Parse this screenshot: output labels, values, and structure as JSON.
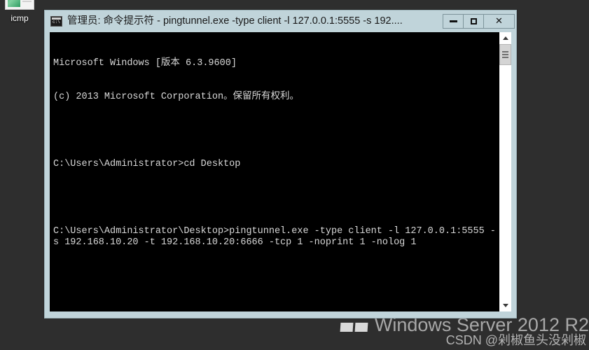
{
  "desktop": {
    "background_color": "#2e2e2e",
    "shortcuts": [
      {
        "label": "icmp",
        "icon": "document-preview-icon"
      }
    ],
    "watermark": {
      "product": "Windows Server 2012 R2",
      "logo_icon": "windows-logo-icon"
    },
    "attribution": "CSDN @剁椒鱼头没剁椒"
  },
  "console_window": {
    "titlebar": {
      "icon": "command-prompt-icon",
      "title": "管理员: 命令提示符 - pingtunnel.exe  -type client -l 127.0.0.1:5555 -s 192....",
      "buttons": {
        "minimize": {
          "icon": "minimize-icon",
          "label": "—"
        },
        "maximize": {
          "icon": "maximize-icon",
          "label": "□"
        },
        "close": {
          "icon": "close-icon",
          "label": "✕"
        }
      },
      "background_color": "#c0d4da"
    },
    "console": {
      "background_color": "#000000",
      "foreground_color": "#d8d8d8",
      "lines": [
        "Microsoft Windows [版本 6.3.9600]",
        "(c) 2013 Microsoft Corporation。保留所有权利。",
        "",
        "C:\\Users\\Administrator>cd Desktop",
        "",
        "C:\\Users\\Administrator\\Desktop>pingtunnel.exe -type client -l 127.0.0.1:5555 -s 192.168.10.20 -t 192.168.10.20:6666 -tcp 1 -noprint 1 -nolog 1"
      ]
    },
    "scrollbar": {
      "up_arrow_icon": "chevron-up-icon",
      "down_arrow_icon": "chevron-down-icon",
      "thumb_grip_icon": "grip-lines-icon"
    }
  }
}
